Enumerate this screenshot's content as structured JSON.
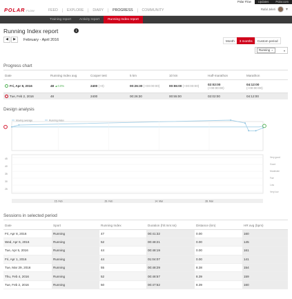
{
  "topbar": {
    "tabs": [
      "Polar Flow",
      "Updates",
      "Polar.com"
    ],
    "active_tab": "Polar Flow"
  },
  "brand": {
    "logo": "POLAR",
    "product": "FLOW",
    "color": "#d0021b"
  },
  "nav": {
    "items": [
      "FEED",
      "EXPLORE",
      "DIARY",
      "PROGRESS",
      "COMMUNITY"
    ],
    "active": "PROGRESS",
    "user": {
      "name": "Rafal Jeleń",
      "caret": "▾",
      "settings_icon": "gear-icon"
    }
  },
  "subnav": {
    "items": [
      "Training report",
      "Activity report",
      "Running Index report"
    ],
    "active": "Running Index report"
  },
  "page": {
    "title": "Running Index report",
    "info_icon": "i",
    "prev": "◀",
    "next": "▶",
    "date_range": "February - April 2016"
  },
  "period_buttons": {
    "items": [
      "Month",
      "3 months",
      "Custom period"
    ],
    "active": "3 months"
  },
  "sport_filter": {
    "selected": "Running",
    "remove": "×",
    "caret": "▾"
  },
  "progress_chart": {
    "title": "Progress chart",
    "headers": [
      "Date",
      "Running Index avg",
      "Cooper test",
      "5 km",
      "10 km",
      "Half-marathon",
      "Marathon"
    ],
    "rows": [
      {
        "date": "Fri, Apr 8, 2016",
        "ri": "48",
        "ri_change": "▲0.0%",
        "cooper": "2400",
        "cooper_change": "(+0)",
        "km5": "00:26:30",
        "km5_change": "(+00:00:00)",
        "km10": "00:55:00",
        "km10_change": "(+00:00:00)",
        "half": "02:02:00",
        "half_change": "(+00:00:00)",
        "marathon": "04:12:00",
        "marathon_change": "(+00:00:00)"
      },
      {
        "date": "Tue, Feb 2, 2016",
        "ri": "48",
        "cooper": "2400",
        "km5": "00:26:30",
        "km10": "00:55:00",
        "half": "02:02:00",
        "marathon": "04:12:00"
      }
    ]
  },
  "design_analysis": {
    "title": "Design analysis"
  },
  "chart_data": {
    "type": "line",
    "series": [
      {
        "name": "Moving average",
        "color": "#a5d0e8",
        "values": [
          48,
          48,
          48,
          48,
          48,
          48,
          48,
          48,
          48,
          48,
          48,
          48,
          48,
          48,
          48,
          48,
          48,
          48,
          48,
          48,
          48,
          48,
          48,
          48,
          48,
          48,
          48,
          48,
          48,
          48,
          48,
          48,
          48,
          48,
          48,
          48,
          48,
          48,
          48,
          48,
          48,
          48,
          48,
          48,
          48,
          48,
          48,
          48,
          48,
          48,
          48,
          48,
          48,
          48,
          48,
          48,
          48,
          48,
          48,
          48,
          48,
          48,
          48,
          48,
          48,
          48,
          48,
          48,
          48,
          48,
          49
        ]
      },
      {
        "name": "Running Index",
        "color": "#a5d0e8",
        "points": [
          [
            0,
            48
          ],
          [
            2,
            50
          ],
          [
            61,
            55
          ],
          [
            65,
            52
          ],
          [
            66,
            44
          ],
          [
            68,
            44
          ],
          [
            70,
            47
          ]
        ]
      }
    ],
    "x_tick_labels": [
      "15. Feb",
      "29. Feb",
      "14. Mar",
      "28. Mar"
    ],
    "y_tick_labels": [
      "45",
      "40",
      "35",
      "30",
      "25"
    ],
    "y_range": [
      25,
      55
    ],
    "right_zone_labels": [
      "Very good",
      "Good",
      "Moderate",
      "Fair",
      "Low",
      "Very low"
    ],
    "legend_position": "top-left",
    "start_marker_color": "#d0021b",
    "end_marker_color": "#4caf50"
  },
  "sessions": {
    "title": "Sessions in selected period",
    "headers": [
      "Date",
      "Sport",
      "Running Index",
      "Duration (hh:mm:ss)",
      "Distance (km)",
      "HR avg (bpm)"
    ],
    "rows": [
      [
        "Fri, Apr 8, 2016",
        "Running",
        "47",
        "00:41:32",
        "0.00",
        "160"
      ],
      [
        "Wed, Apr 6, 2016",
        "Running",
        "52",
        "00:48:21",
        "0.00",
        "145"
      ],
      [
        "Tue, Apr 5, 2016",
        "Running",
        "44",
        "00:48:19",
        "0.00",
        "161"
      ],
      [
        "Fri, Apr 1, 2016",
        "Running",
        "44",
        "01:04:07",
        "0.00",
        "141"
      ],
      [
        "Tue, Mar 29, 2016",
        "Running",
        "55",
        "00:48:29",
        "8.38",
        "154"
      ],
      [
        "Thu, Feb 4, 2016",
        "Running",
        "52",
        "00:48:57",
        "8.39",
        "159"
      ],
      [
        "Tue, Feb 2, 2016",
        "Running",
        "50",
        "00:47:52",
        "8.39",
        "160"
      ]
    ]
  }
}
